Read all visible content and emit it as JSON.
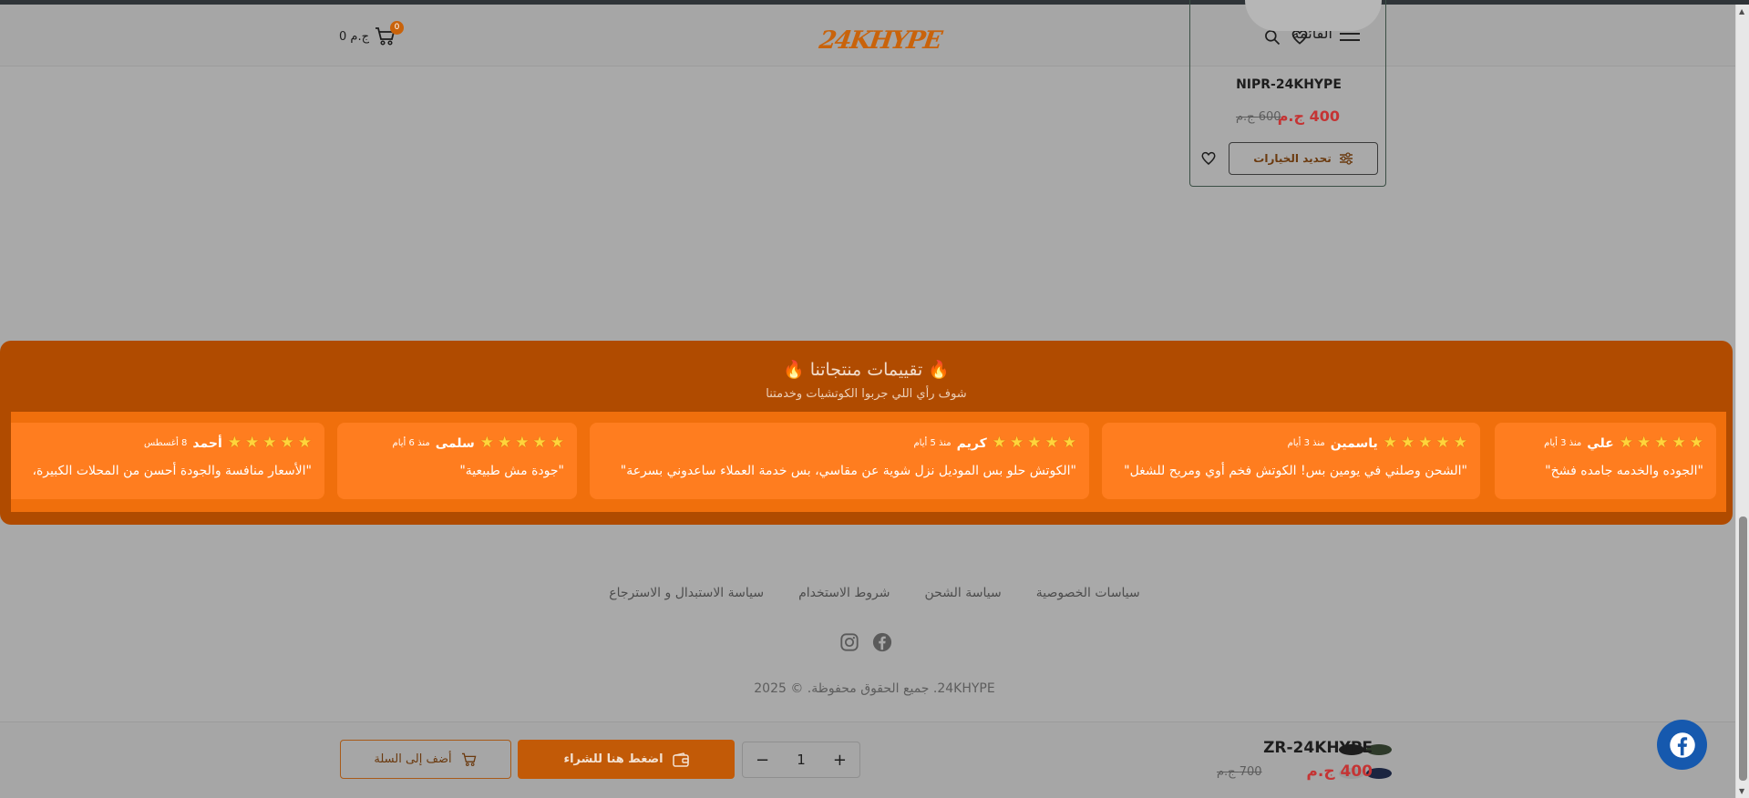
{
  "header": {
    "menu_label": "القائمة",
    "logo_text": "24KHYPE",
    "cart_total": "0 ج.م",
    "cart_count": "0",
    "accent_color": "#c9630b"
  },
  "product_card": {
    "name": "NIPR-24KHYPE",
    "price": "400 ج.م",
    "old_price": "600 ج.م",
    "options_label": "تحديد الخيارات"
  },
  "reviews": {
    "title": "🔥 تقييمات منتجاتنا 🔥",
    "subtitle": "شوف رأي اللي جربوا الكوتشيات وخدمتنا",
    "items": [
      {
        "name": "علي",
        "date": "منذ 3 أيام",
        "rating": 5,
        "text": "\"الجوده والخدمه جامده فشخ\""
      },
      {
        "name": "ياسمين",
        "date": "منذ 3 أيام",
        "rating": 5,
        "text": "\"الشحن وصلني في يومين بس! الكوتش فخم أوي ومريح للشغل\""
      },
      {
        "name": "كريم",
        "date": "منذ 5 أيام",
        "rating": 5,
        "text": "\"الكوتش حلو بس الموديل نزل شوية عن مقاسي، بس خدمة العملاء ساعدوني بسرعة\""
      },
      {
        "name": "سلمى",
        "date": "منذ 6 أيام",
        "rating": 5,
        "text": "\"جودة مش طبيعية\""
      },
      {
        "name": "أحمد",
        "date": "8 أغسطس",
        "rating": 5,
        "text": "\"الأسعار منافسة والجودة أحسن من المحلات الكبيرة،"
      }
    ]
  },
  "footer": {
    "links": [
      "سياسات الخصوصية",
      "سياسة الشحن",
      "شروط الاستخدام",
      "سياسة الاستبدال و الاسترجاع"
    ],
    "copyright": "24KHYPE. جميع الحقوق محفوظة. © 2025"
  },
  "sticky_bar": {
    "product_name": "ZR-24KHYPE",
    "price": "400 ج.م",
    "old_price": "700 ج.م",
    "quantity": "1",
    "buy_label": "اضغط هنا للشراء",
    "add_label": "أضف إلى السلة"
  }
}
